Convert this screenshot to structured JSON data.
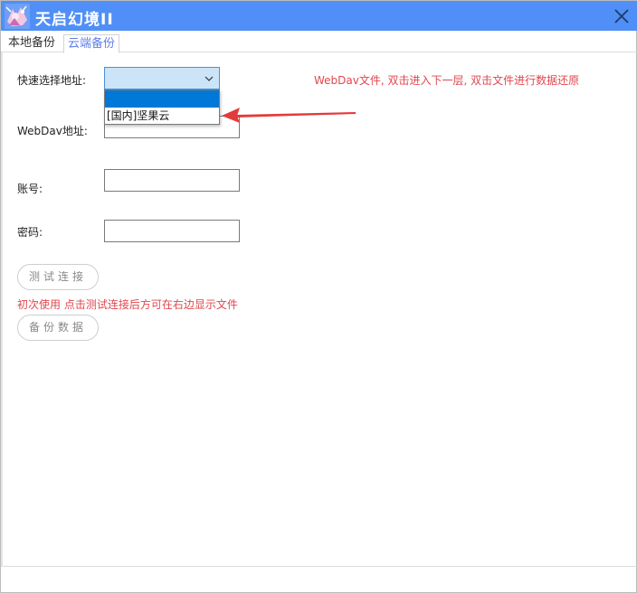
{
  "window": {
    "title": "天启幻境II",
    "logo_icon": "anime-character-logo-icon",
    "close_icon": "close-icon",
    "titlebar_color": "#4f8ff7"
  },
  "tabs": [
    {
      "label": "本地备份",
      "active": false
    },
    {
      "label": "云端备份",
      "active": true
    }
  ],
  "form": {
    "quick_select_label": "快速选择地址:",
    "quick_select_value": "",
    "dropdown_options": [
      "",
      "[国内]坚果云"
    ],
    "webdav_label": "WebDav地址:",
    "webdav_value": "",
    "account_label": "账号:",
    "account_value": "",
    "password_label": "密码:",
    "password_value": ""
  },
  "buttons": {
    "test_connection": "测试连接",
    "backup_data": "备份数据"
  },
  "hints": {
    "first_use": "初次使用 点击测试连接后方可在右边显示文件",
    "webdav_help": "WebDav文件, 双击进入下一层, 双击文件进行数据还原"
  },
  "colors": {
    "accent": "#4f8ff7",
    "hint_red": "#e0474e",
    "tab_active": "#5f7fe8",
    "select_highlight": "#0078d7"
  }
}
